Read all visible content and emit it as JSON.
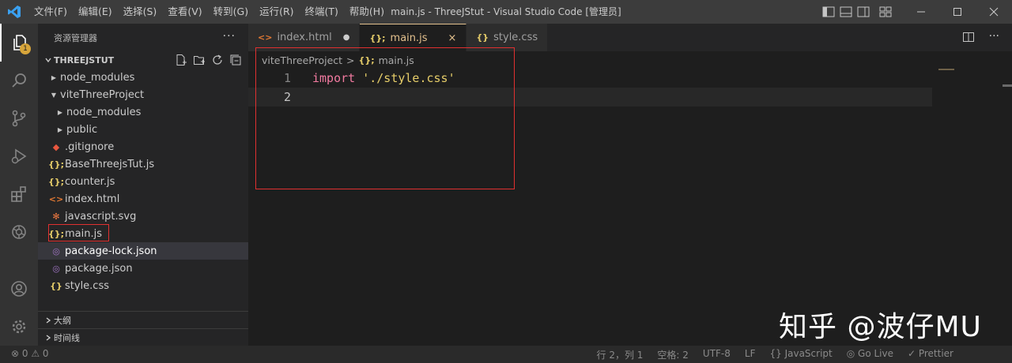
{
  "menu": [
    "文件(F)",
    "编辑(E)",
    "选择(S)",
    "查看(V)",
    "转到(G)",
    "运行(R)",
    "终端(T)",
    "帮助(H)"
  ],
  "window_title": "main.js - ThreeJStut - Visual Studio Code [管理员]",
  "activity": {
    "explorer_badge": "1"
  },
  "explorer": {
    "header": "资源管理器",
    "more": "···",
    "root": "THREEJSTUT",
    "items": [
      {
        "label": "node_modules",
        "type": "folder",
        "depth": 0
      },
      {
        "label": "viteThreeProject",
        "type": "folder-open",
        "depth": 0
      },
      {
        "label": "node_modules",
        "type": "folder",
        "depth": 1
      },
      {
        "label": "public",
        "type": "folder",
        "depth": 1
      },
      {
        "label": ".gitignore",
        "type": "git",
        "depth": 1
      },
      {
        "label": "BaseThreejsTut.js",
        "type": "js",
        "depth": 1
      },
      {
        "label": "counter.js",
        "type": "js",
        "depth": 1
      },
      {
        "label": "index.html",
        "type": "html",
        "depth": 1
      },
      {
        "label": "javascript.svg",
        "type": "svg",
        "depth": 1
      },
      {
        "label": "main.js",
        "type": "js",
        "depth": 1
      },
      {
        "label": "package-lock.json",
        "type": "json",
        "depth": 1
      },
      {
        "label": "package.json",
        "type": "json",
        "depth": 1
      },
      {
        "label": "style.css",
        "type": "css",
        "depth": 1
      }
    ],
    "outline": "大纲",
    "timeline": "时间线"
  },
  "tabs": [
    {
      "label": "index.html",
      "icon": "<>",
      "state": "modified"
    },
    {
      "label": "main.js",
      "icon": "{};",
      "state": "active"
    },
    {
      "label": "style.css",
      "icon": "{}",
      "state": "normal"
    }
  ],
  "tab_close": "×",
  "tab_dot": "●",
  "breadcrumb": {
    "folder": "viteThreeProject",
    "sep": ">",
    "file": "main.js",
    "file_icon": "{};"
  },
  "code": {
    "line1_no": "1",
    "line2_no": "2",
    "line1_keyword": "import",
    "line1_string": "'./style.css'"
  },
  "watermark": "知乎 @波仔MU",
  "status": {
    "problems": "⊗ 0 ⚠ 0",
    "right": [
      "行 2，列 1",
      "空格: 2",
      "UTF-8",
      "LF",
      "{} JavaScript",
      "◎ Go Live",
      "✓ Prettier"
    ]
  },
  "colors": {
    "accent_tab": "#e2c08d",
    "highlight_box": "#e03030",
    "keyword": "#f27aa0",
    "string": "#e6cd69"
  }
}
